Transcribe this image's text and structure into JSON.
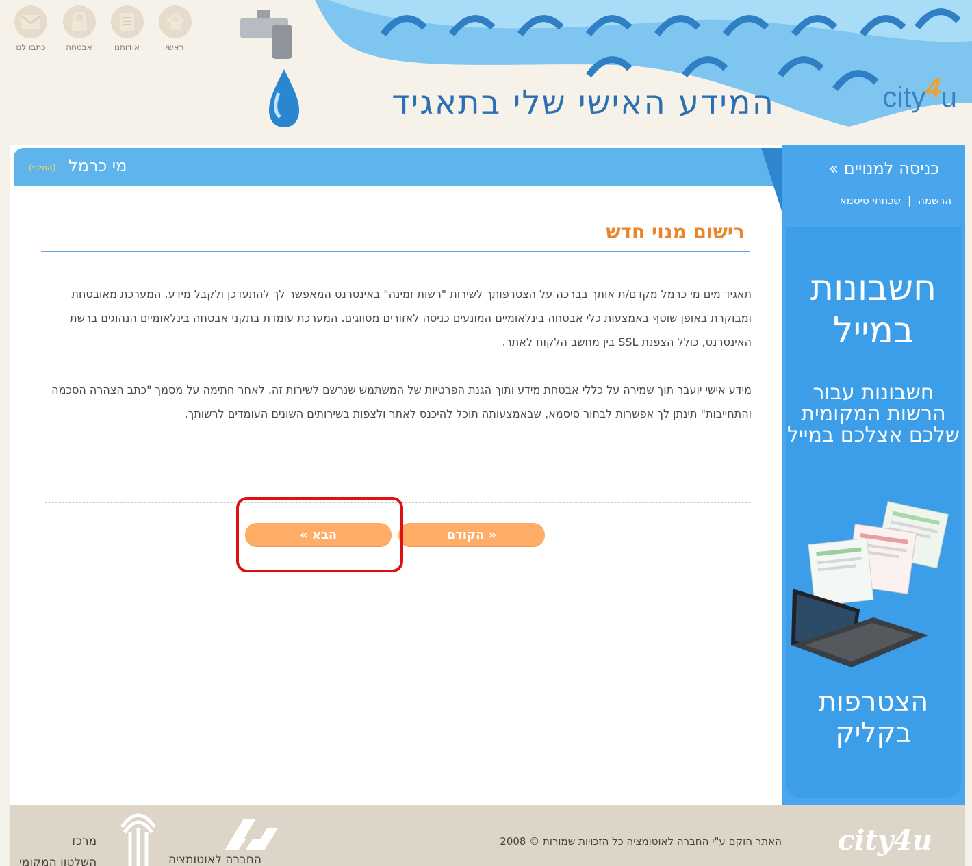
{
  "header": {
    "title": "המידע האישי שלי בתאגיד",
    "brand_prefix": "city",
    "brand_four": "4",
    "brand_suffix": "u",
    "nav": [
      {
        "label": "ראשי",
        "icon": "home-icon"
      },
      {
        "label": "אודותנו",
        "icon": "info-icon"
      },
      {
        "label": "אבטחה",
        "icon": "lock-icon"
      },
      {
        "label": "כתבו לנו",
        "icon": "mail-icon"
      }
    ]
  },
  "provider": {
    "name": "מי כרמל",
    "change_label": "(החלף)"
  },
  "main": {
    "heading": "רישום מנוי חדש",
    "paragraphs": [
      "תאגיד מים מי כרמל  מקדם/ת אותך בברכה על הצטרפותך לשירות \"רשות זמינה\" באינטרנט המאפשר לך להתעדכן ולקבל מידע. המערכת מאובטחת ומבוקרת באופן שוטף באמצעות כלי אבטחה בינלאומיים המונעים כניסה לאזורים מסווגים. המערכת עומדת בתקני אבטחה בינלאומיים הנהוגים ברשת האינטרנט, כולל הצפנת SSL בין מחשב הלקוח לאתר.",
      "מידע אישי יועבר תוך שמירה על כללי אבטחת מידע ותוך הגנת הפרטיות של המשתמש שנרשם לשירות זה. לאחר חתימה על מסמך \"כתב הצהרה הסכמה והתחייבות\" תינתן לך אפשרות לבחור סיסמא, שבאמצעותה תוכל להיכנס לאתר ולצפות בשירותים השונים העומדים לרשותך."
    ],
    "next_label": "הבא »",
    "prev_label": "« הקודם"
  },
  "sidebar": {
    "login_label": "כניסה למנויים »",
    "register_label": "הרשמה",
    "separator": "|",
    "forgot_label": "שכחתי סיסמא",
    "promo_title": "חשבונות במייל",
    "promo_body": "חשבונות עבור הרשות המקומית שלכם אצלכם במייל",
    "promo_cta": "הצטרפות בקליק"
  },
  "footer": {
    "brand": "city4u",
    "copyright": "האתר הוקם ע\"י החברה לאוטומציה כל הזכויות שמורות © 2008",
    "automation_label": "החברה לאוטומציה",
    "center_label_line1": "מרכז",
    "center_label_line2": "השלטון המקומי"
  },
  "colors": {
    "accent_blue": "#4aa6ec",
    "heading_orange": "#e9862b",
    "button_orange": "#ffad66",
    "highlight_red": "#e01010"
  }
}
